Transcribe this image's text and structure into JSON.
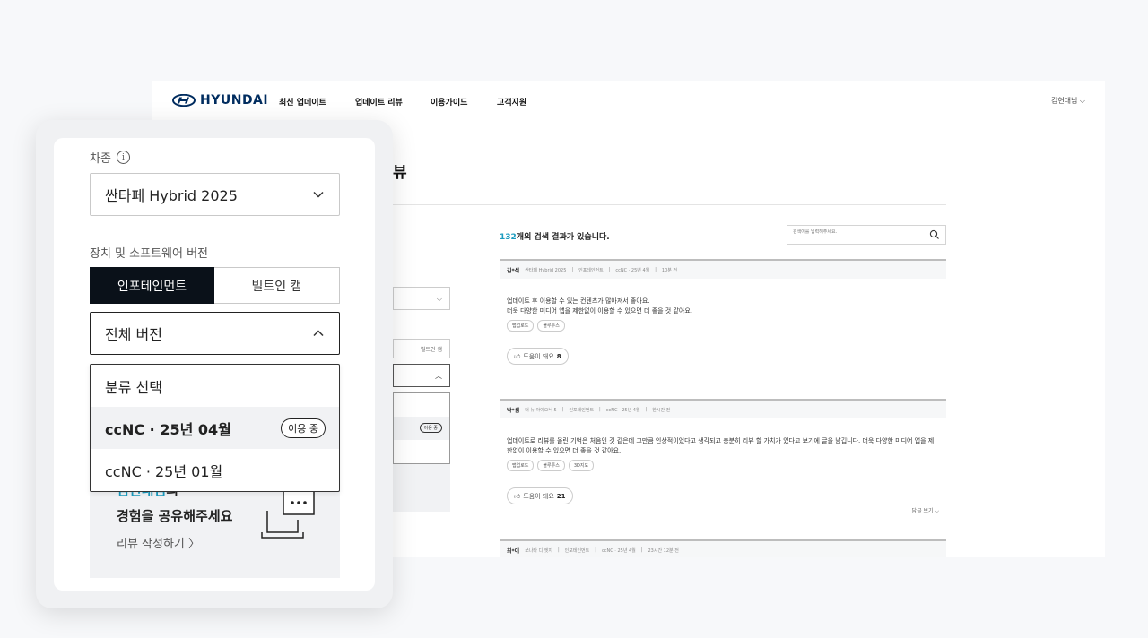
{
  "brand": {
    "logo_text": "HYUNDAI",
    "color": "#002c5f"
  },
  "nav": {
    "items": [
      "최신 업데이트",
      "업데이트 리뷰",
      "이용가이드",
      "고객지원"
    ],
    "user_menu": "김현대님 ⌵"
  },
  "page": {
    "title_partial": "뷰",
    "mini_filter": {
      "tab_label": "빌트인 캠",
      "badge": "이용 중"
    }
  },
  "results": {
    "count": "132",
    "suffix": "개의 검색 결과가 있습니다.",
    "search_placeholder": "검색어를 입력해주세요."
  },
  "reviews": [
    {
      "author": "김*석",
      "meta": [
        "싼타페 Hybrid 2025",
        "인포테인먼트",
        "ccNC · 25년 4월",
        "10분 전"
      ],
      "text": "업데이트 후 이용할 수 있는 컨텐츠가 많아져서 좋아요.\n더욱 다양한 미디어 앱을 제한없이 이용할 수 있으면 더 좋을 것 같아요.",
      "tags": [
        "맵업로드",
        "블루투스"
      ],
      "helpful_label": "도움이 돼요",
      "helpful_count": "8"
    },
    {
      "author": "박*셈",
      "meta": [
        "더 뉴 아이오닉 5",
        "인포테인먼트",
        "ccNC · 25년 4월",
        "한시간 전"
      ],
      "text": "업데이트로 리뷰를 올린 기억은 처음인 것 같은데 그만큼 인상적이었다고 생각되고 충분히 리뷰 할 가치가 있다고 보기에 글을 남깁니다. 더욱 다양한 미디어 앱을 제한없이 이용할 수 있으면 더 좋을 것 같아요.",
      "tags": [
        "맵업로드",
        "블루투스",
        "3D지도"
      ],
      "helpful_label": "도움이 돼요",
      "helpful_count": "21",
      "reply_toggle": "답글 보기 ⌵"
    },
    {
      "author": "최*이",
      "meta": [
        "쏘나타 디 엣지",
        "인포테인먼트",
        "ccNC · 25년 4월",
        "23시간 12분 전"
      ]
    }
  ],
  "panel": {
    "car_label": "차종",
    "car_value": "싼타페 Hybrid 2025",
    "device_label": "장치 및 소프트웨어 버전",
    "seg_tabs": [
      "인포테인먼트",
      "빌트인 캠"
    ],
    "version_value": "전체 버전",
    "dropdown_options": [
      {
        "label": "분류 선택"
      },
      {
        "label": "ccNC · 25년 04월",
        "badge": "이용 중"
      },
      {
        "label": "ccNC · 25년 01월"
      }
    ],
    "card": {
      "name": "김현대님",
      "name_suffix": "의",
      "line2": "경험을 공유해주세요",
      "link": "리뷰 작성하기 〉"
    }
  },
  "colors": {
    "accent": "#1a9bbf",
    "active_tab": "#0a1119"
  }
}
